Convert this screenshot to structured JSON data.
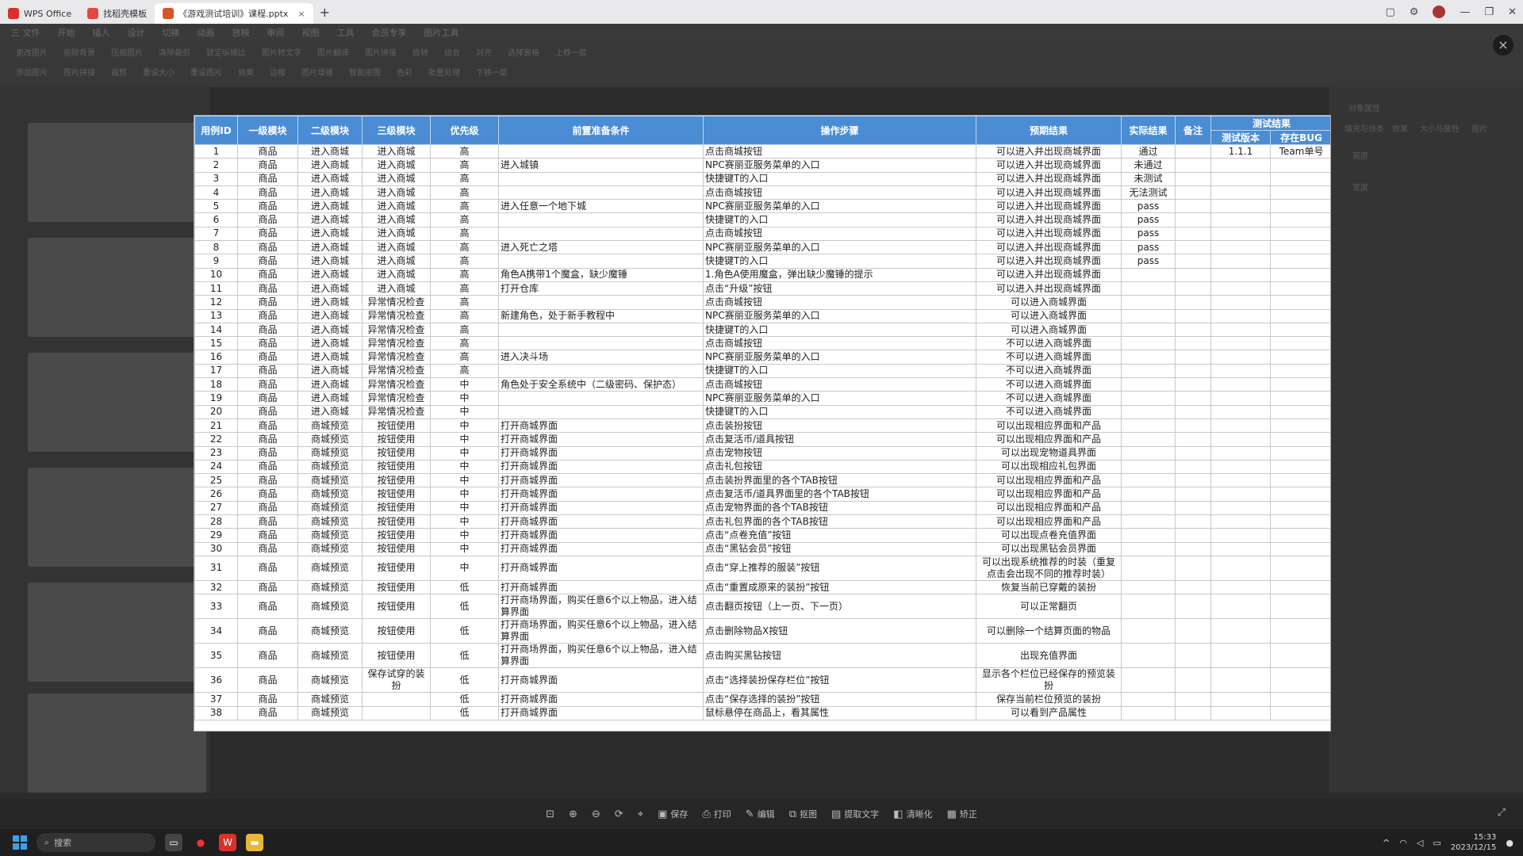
{
  "titlebar": {
    "tabs": [
      {
        "label": "WPS Office",
        "icon": "wps-logo-icon",
        "active": false
      },
      {
        "label": "找稻壳模板",
        "icon": "docer-icon",
        "active": false
      },
      {
        "label": "《游戏测试培训》课程.pptx",
        "icon": "pptx-file-icon",
        "active": true
      }
    ],
    "new_tab": "+"
  },
  "menubar": {
    "items": [
      "三 文件",
      "开始",
      "插入",
      "设计",
      "切换",
      "动画",
      "放映",
      "审阅",
      "视图",
      "工具",
      "会员专享",
      "图片工具"
    ]
  },
  "ribbon": {
    "row1": [
      "更改图片",
      "抠除背景",
      "压缩图片",
      "清除裁剪",
      "锁定纵横比",
      "图片转文字",
      "图片翻译",
      "图片拼接",
      "旋转",
      "组合",
      "对齐",
      "选择窗格",
      "上移一层"
    ],
    "row2": [
      "添加图片",
      "图片拼接",
      "裁剪",
      "重设大小",
      "重设图片",
      "效果",
      "边框",
      "图片增强",
      "智能抠图",
      "色彩",
      "批量处理",
      "下移一层"
    ]
  },
  "right_panel": {
    "title": "对象属性",
    "tabs": [
      "填充与线条",
      "效果",
      "大小与属性",
      "图片"
    ],
    "fields": [
      "高度",
      "宽度"
    ]
  },
  "viewer": {
    "close": "×"
  },
  "sheet": {
    "headers": {
      "id": "用例ID",
      "m1": "一级模块",
      "m2": "二级模块",
      "m3": "三级模块",
      "priority": "优先级",
      "precondition": "前置准备条件",
      "steps": "操作步骤",
      "expected": "预期结果",
      "actual": "实际结果",
      "remark": "备注",
      "test_result": "测试结果",
      "test_version": "测试版本",
      "bug": "存在BUG"
    },
    "rows": [
      {
        "id": "1",
        "m1": "商品",
        "m2": "进入商城",
        "m3": "进入商城",
        "p": "高",
        "pre": "",
        "step": "点击商城按钮",
        "exp": "可以进入并出现商城界面",
        "act": "通过",
        "rem": "",
        "ver": "1.1.1",
        "bug": "Team单号"
      },
      {
        "id": "2",
        "m1": "商品",
        "m2": "进入商城",
        "m3": "进入商城",
        "p": "高",
        "pre": "进入城镇",
        "step": "NPC赛丽亚服务菜单的入口",
        "exp": "可以进入并出现商城界面",
        "act": "未通过",
        "rem": "",
        "ver": "",
        "bug": ""
      },
      {
        "id": "3",
        "m1": "商品",
        "m2": "进入商城",
        "m3": "进入商城",
        "p": "高",
        "pre": "",
        "step": "快捷键T的入口",
        "exp": "可以进入并出现商城界面",
        "act": "未测试",
        "rem": "",
        "ver": "",
        "bug": ""
      },
      {
        "id": "4",
        "m1": "商品",
        "m2": "进入商城",
        "m3": "进入商城",
        "p": "高",
        "pre": "",
        "step": "点击商城按钮",
        "exp": "可以进入并出现商城界面",
        "act": "无法测试",
        "rem": "",
        "ver": "",
        "bug": ""
      },
      {
        "id": "5",
        "m1": "商品",
        "m2": "进入商城",
        "m3": "进入商城",
        "p": "高",
        "pre": "进入任意一个地下城",
        "step": "NPC赛丽亚服务菜单的入口",
        "exp": "可以进入并出现商城界面",
        "act": "pass",
        "rem": "",
        "ver": "",
        "bug": ""
      },
      {
        "id": "6",
        "m1": "商品",
        "m2": "进入商城",
        "m3": "进入商城",
        "p": "高",
        "pre": "",
        "step": "快捷键T的入口",
        "exp": "可以进入并出现商城界面",
        "act": "pass",
        "rem": "",
        "ver": "",
        "bug": ""
      },
      {
        "id": "7",
        "m1": "商品",
        "m2": "进入商城",
        "m3": "进入商城",
        "p": "高",
        "pre": "",
        "step": "点击商城按钮",
        "exp": "可以进入并出现商城界面",
        "act": "pass",
        "rem": "",
        "ver": "",
        "bug": ""
      },
      {
        "id": "8",
        "m1": "商品",
        "m2": "进入商城",
        "m3": "进入商城",
        "p": "高",
        "pre": "进入死亡之塔",
        "step": "NPC赛丽亚服务菜单的入口",
        "exp": "可以进入并出现商城界面",
        "act": "pass",
        "rem": "",
        "ver": "",
        "bug": ""
      },
      {
        "id": "9",
        "m1": "商品",
        "m2": "进入商城",
        "m3": "进入商城",
        "p": "高",
        "pre": "",
        "step": "快捷键T的入口",
        "exp": "可以进入并出现商城界面",
        "act": "pass",
        "rem": "",
        "ver": "",
        "bug": ""
      },
      {
        "id": "10",
        "m1": "商品",
        "m2": "进入商城",
        "m3": "进入商城",
        "p": "高",
        "pre": "角色A携带1个魔盒，缺少魔锤",
        "step": "1.角色A使用魔盒，弹出缺少魔锤的提示",
        "exp": "可以进入并出现商城界面",
        "act": "",
        "rem": "",
        "ver": "",
        "bug": ""
      },
      {
        "id": "11",
        "m1": "商品",
        "m2": "进入商城",
        "m3": "进入商城",
        "p": "高",
        "pre": "打开仓库",
        "step": "点击“升级”按钮",
        "exp": "可以进入并出现商城界面",
        "act": "",
        "rem": "",
        "ver": "",
        "bug": ""
      },
      {
        "id": "12",
        "m1": "商品",
        "m2": "进入商城",
        "m3": "异常情况检查",
        "p": "高",
        "pre": "",
        "step": "点击商城按钮",
        "exp": "可以进入商城界面",
        "act": "",
        "rem": "",
        "ver": "",
        "bug": ""
      },
      {
        "id": "13",
        "m1": "商品",
        "m2": "进入商城",
        "m3": "异常情况检查",
        "p": "高",
        "pre": "新建角色，处于新手教程中",
        "step": "NPC赛丽亚服务菜单的入口",
        "exp": "可以进入商城界面",
        "act": "",
        "rem": "",
        "ver": "",
        "bug": ""
      },
      {
        "id": "14",
        "m1": "商品",
        "m2": "进入商城",
        "m3": "异常情况检查",
        "p": "高",
        "pre": "",
        "step": "快捷键T的入口",
        "exp": "可以进入商城界面",
        "act": "",
        "rem": "",
        "ver": "",
        "bug": ""
      },
      {
        "id": "15",
        "m1": "商品",
        "m2": "进入商城",
        "m3": "异常情况检查",
        "p": "高",
        "pre": "",
        "step": "点击商城按钮",
        "exp": "不可以进入商城界面",
        "act": "",
        "rem": "",
        "ver": "",
        "bug": ""
      },
      {
        "id": "16",
        "m1": "商品",
        "m2": "进入商城",
        "m3": "异常情况检查",
        "p": "高",
        "pre": "进入决斗场",
        "step": "NPC赛丽亚服务菜单的入口",
        "exp": "不可以进入商城界面",
        "act": "",
        "rem": "",
        "ver": "",
        "bug": ""
      },
      {
        "id": "17",
        "m1": "商品",
        "m2": "进入商城",
        "m3": "异常情况检查",
        "p": "高",
        "pre": "",
        "step": "快捷键T的入口",
        "exp": "不可以进入商城界面",
        "act": "",
        "rem": "",
        "ver": "",
        "bug": ""
      },
      {
        "id": "18",
        "m1": "商品",
        "m2": "进入商城",
        "m3": "异常情况检查",
        "p": "中",
        "pre": "角色处于安全系统中（二级密码、保护态）",
        "step": "点击商城按钮",
        "exp": "不可以进入商城界面",
        "act": "",
        "rem": "",
        "ver": "",
        "bug": ""
      },
      {
        "id": "19",
        "m1": "商品",
        "m2": "进入商城",
        "m3": "异常情况检查",
        "p": "中",
        "pre": "",
        "step": "NPC赛丽亚服务菜单的入口",
        "exp": "不可以进入商城界面",
        "act": "",
        "rem": "",
        "ver": "",
        "bug": ""
      },
      {
        "id": "20",
        "m1": "商品",
        "m2": "进入商城",
        "m3": "异常情况检查",
        "p": "中",
        "pre": "",
        "step": "快捷键T的入口",
        "exp": "不可以进入商城界面",
        "act": "",
        "rem": "",
        "ver": "",
        "bug": ""
      },
      {
        "id": "21",
        "m1": "商品",
        "m2": "商城预览",
        "m3": "按钮使用",
        "p": "中",
        "pre": "打开商城界面",
        "step": "点击装扮按钮",
        "exp": "可以出现相应界面和产品",
        "act": "",
        "rem": "",
        "ver": "",
        "bug": ""
      },
      {
        "id": "22",
        "m1": "商品",
        "m2": "商城预览",
        "m3": "按钮使用",
        "p": "中",
        "pre": "打开商城界面",
        "step": "点击复活币/道具按钮",
        "exp": "可以出现相应界面和产品",
        "act": "",
        "rem": "",
        "ver": "",
        "bug": ""
      },
      {
        "id": "23",
        "m1": "商品",
        "m2": "商城预览",
        "m3": "按钮使用",
        "p": "中",
        "pre": "打开商城界面",
        "step": "点击宠物按钮",
        "exp": "可以出现宠物道具界面",
        "act": "",
        "rem": "",
        "ver": "",
        "bug": ""
      },
      {
        "id": "24",
        "m1": "商品",
        "m2": "商城预览",
        "m3": "按钮使用",
        "p": "中",
        "pre": "打开商城界面",
        "step": "点击礼包按钮",
        "exp": "可以出现相应礼包界面",
        "act": "",
        "rem": "",
        "ver": "",
        "bug": ""
      },
      {
        "id": "25",
        "m1": "商品",
        "m2": "商城预览",
        "m3": "按钮使用",
        "p": "中",
        "pre": "打开商城界面",
        "step": "点击装扮界面里的各个TAB按钮",
        "exp": "可以出现相应界面和产品",
        "act": "",
        "rem": "",
        "ver": "",
        "bug": ""
      },
      {
        "id": "26",
        "m1": "商品",
        "m2": "商城预览",
        "m3": "按钮使用",
        "p": "中",
        "pre": "打开商城界面",
        "step": "点击复活币/道具界面里的各个TAB按钮",
        "exp": "可以出现相应界面和产品",
        "act": "",
        "rem": "",
        "ver": "",
        "bug": ""
      },
      {
        "id": "27",
        "m1": "商品",
        "m2": "商城预览",
        "m3": "按钮使用",
        "p": "中",
        "pre": "打开商城界面",
        "step": "点击宠物界面的各个TAB按钮",
        "exp": "可以出现相应界面和产品",
        "act": "",
        "rem": "",
        "ver": "",
        "bug": ""
      },
      {
        "id": "28",
        "m1": "商品",
        "m2": "商城预览",
        "m3": "按钮使用",
        "p": "中",
        "pre": "打开商城界面",
        "step": "点击礼包界面的各个TAB按钮",
        "exp": "可以出现相应界面和产品",
        "act": "",
        "rem": "",
        "ver": "",
        "bug": ""
      },
      {
        "id": "29",
        "m1": "商品",
        "m2": "商城预览",
        "m3": "按钮使用",
        "p": "中",
        "pre": "打开商城界面",
        "step": "点击“点卷充值”按钮",
        "exp": "可以出现点卷充值界面",
        "act": "",
        "rem": "",
        "ver": "",
        "bug": ""
      },
      {
        "id": "30",
        "m1": "商品",
        "m2": "商城预览",
        "m3": "按钮使用",
        "p": "中",
        "pre": "打开商城界面",
        "step": "点击“黑钻会员”按钮",
        "exp": "可以出现黑钻会员界面",
        "act": "",
        "rem": "",
        "ver": "",
        "bug": ""
      },
      {
        "id": "31",
        "m1": "商品",
        "m2": "商城预览",
        "m3": "按钮使用",
        "p": "中",
        "pre": "打开商城界面",
        "step": "点击“穿上推荐的服装”按钮",
        "exp": "可以出现系统推荐的时装（重复点击会出现不同的推荐时装）",
        "act": "",
        "rem": "",
        "ver": "",
        "bug": "",
        "tall": true
      },
      {
        "id": "32",
        "m1": "商品",
        "m2": "商城预览",
        "m3": "按钮使用",
        "p": "低",
        "pre": "打开商城界面",
        "step": "点击“重置成原来的装扮”按钮",
        "exp": "恢复当前已穿戴的装扮",
        "act": "",
        "rem": "",
        "ver": "",
        "bug": ""
      },
      {
        "id": "33",
        "m1": "商品",
        "m2": "商城预览",
        "m3": "按钮使用",
        "p": "低",
        "pre": "打开商场界面，购买任意6个以上物品，进入结算界面",
        "step": "点击翻页按钮（上一页、下一页）",
        "exp": "可以正常翻页",
        "act": "",
        "rem": "",
        "ver": "",
        "bug": "",
        "tall": true
      },
      {
        "id": "34",
        "m1": "商品",
        "m2": "商城预览",
        "m3": "按钮使用",
        "p": "低",
        "pre": "打开商场界面，购买任意6个以上物品，进入结算界面",
        "step": "点击删除物品X按钮",
        "exp": "可以删除一个结算页面的物品",
        "act": "",
        "rem": "",
        "ver": "",
        "bug": "",
        "tall": true
      },
      {
        "id": "35",
        "m1": "商品",
        "m2": "商城预览",
        "m3": "按钮使用",
        "p": "低",
        "pre": "打开商场界面，购买任意6个以上物品，进入结算界面",
        "step": "点击购买黑钻按钮",
        "exp": "出现充值界面",
        "act": "",
        "rem": "",
        "ver": "",
        "bug": "",
        "tall": true
      },
      {
        "id": "36",
        "m1": "商品",
        "m2": "商城预览",
        "m3": "保存试穿的装扮",
        "p": "低",
        "pre": "打开商城界面",
        "step": "点击“选择装扮保存栏位”按钮",
        "exp": "显示各个栏位已经保存的预览装扮",
        "act": "",
        "rem": "",
        "ver": "",
        "bug": "",
        "tall": true
      },
      {
        "id": "37",
        "m1": "商品",
        "m2": "商城预览",
        "m3": "",
        "p": "低",
        "pre": "打开商城界面",
        "step": "点击“保存选择的装扮”按钮",
        "exp": "保存当前栏位预览的装扮",
        "act": "",
        "rem": "",
        "ver": "",
        "bug": ""
      },
      {
        "id": "38",
        "m1": "商品",
        "m2": "商城预览",
        "m3": "",
        "p": "低",
        "pre": "打开商城界面",
        "step": "鼠标悬停在商品上，看其属性",
        "exp": "可以看到产品属性",
        "act": "",
        "rem": "",
        "ver": "",
        "bug": ""
      }
    ]
  },
  "viewer_toolbar": {
    "buttons": [
      {
        "label": "",
        "icon": "fit-screen-icon"
      },
      {
        "label": "",
        "icon": "zoom-in-icon"
      },
      {
        "label": "",
        "icon": "zoom-out-icon"
      },
      {
        "label": "",
        "icon": "rotate-icon"
      },
      {
        "label": "",
        "icon": "location-pin-icon"
      },
      {
        "label": "保存",
        "icon": "save-icon"
      },
      {
        "label": "打印",
        "icon": "print-icon"
      },
      {
        "label": "编辑",
        "icon": "edit-icon"
      },
      {
        "label": "抠图",
        "icon": "cutout-icon"
      },
      {
        "label": "提取文字",
        "icon": "ocr-icon"
      },
      {
        "label": "清晰化",
        "icon": "sharpen-icon"
      },
      {
        "label": "矫正",
        "icon": "correct-icon"
      }
    ]
  },
  "taskbar": {
    "search_placeholder": "搜索",
    "clock_time": "15:33",
    "clock_date": "2023/12/15"
  },
  "colors": {
    "header_blue": "#4a8dd4",
    "wps_red": "#d9322b"
  }
}
